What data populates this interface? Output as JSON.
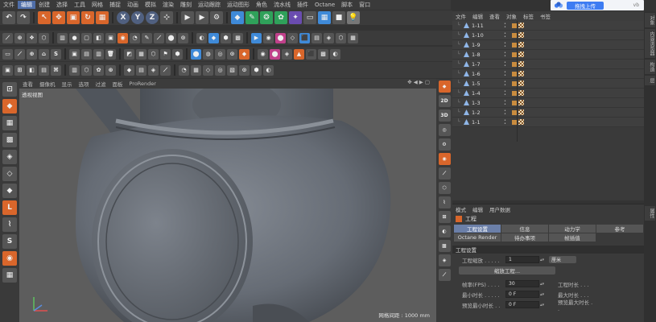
{
  "menubar": {
    "items": [
      "文件",
      "编辑",
      "创建",
      "选择",
      "工具",
      "网格",
      "捕捉",
      "动画",
      "模拟",
      "渲染",
      "雕刻",
      "运动跟踪",
      "运动图形",
      "角色",
      "流水线",
      "插件",
      "Octane",
      "脚本",
      "窗口"
    ],
    "active_index": 1
  },
  "cloud": {
    "upload_label": "拖拽上传",
    "tail": "vb"
  },
  "toolbar1": {
    "axis_x": "X",
    "axis_y": "Y",
    "axis_z": "Z"
  },
  "toolbar2": {
    "label_s": "S"
  },
  "viewport": {
    "menu": [
      "查看",
      "摄像机",
      "显示",
      "选项",
      "过滤",
      "面板",
      "ProRender"
    ],
    "label": "透视视图",
    "grid_info": "网格间距 : 1000 mm",
    "nav_icons": "✥ ◀ ▶ ▢"
  },
  "midtools": {
    "labels": [
      "",
      "2D",
      "3D",
      "",
      "",
      "",
      ""
    ]
  },
  "object_manager": {
    "menu": [
      "文件",
      "编辑",
      "查看",
      "对象",
      "标签",
      "书签"
    ],
    "objects": [
      {
        "name": "1-11"
      },
      {
        "name": "1-10"
      },
      {
        "name": "1-9"
      },
      {
        "name": "1-8"
      },
      {
        "name": "1-7"
      },
      {
        "name": "1-6"
      },
      {
        "name": "1-5"
      },
      {
        "name": "1-4"
      },
      {
        "name": "1-3"
      },
      {
        "name": "1-2"
      },
      {
        "name": "1-1"
      }
    ]
  },
  "attributes": {
    "menu": [
      "模式",
      "编辑",
      "用户数据"
    ],
    "title": "工程",
    "tabs": [
      {
        "label": "工程设置",
        "active": true
      },
      {
        "label": "信息",
        "active": false
      },
      {
        "label": "动力学",
        "active": false
      },
      {
        "label": "参考",
        "active": false
      },
      {
        "label": "Octane Render",
        "active": false
      },
      {
        "label": "待办事项",
        "active": false
      },
      {
        "label": "帧插值",
        "active": false
      }
    ],
    "section": "工程设置",
    "scale_label": "工程缩放 . . . . .",
    "scale_value": "1",
    "scale_unit": "厘米",
    "reset_button": "缩放工程...",
    "fps_label": "帧率(FPS) . . . .",
    "fps_value": "30",
    "mintime_label": "最小时长 . . . . .",
    "mintime_value": "0 F",
    "preview_min_label": "预览最小时长 . .",
    "preview_min_value": "0 F",
    "project_time_label": "工程时长 . . .",
    "max_time_label": "最大时长 . . .",
    "preview_max_label": "预览最大时长 . ."
  },
  "right_tabs": [
    "对象",
    "内容浏览器",
    "构造",
    "层",
    "属性"
  ],
  "colors": {
    "accent": "#3d7cf2",
    "viewport_bg": "#5d5d5d",
    "model": "#6f7680",
    "tab_active": "#6b7fa8"
  }
}
